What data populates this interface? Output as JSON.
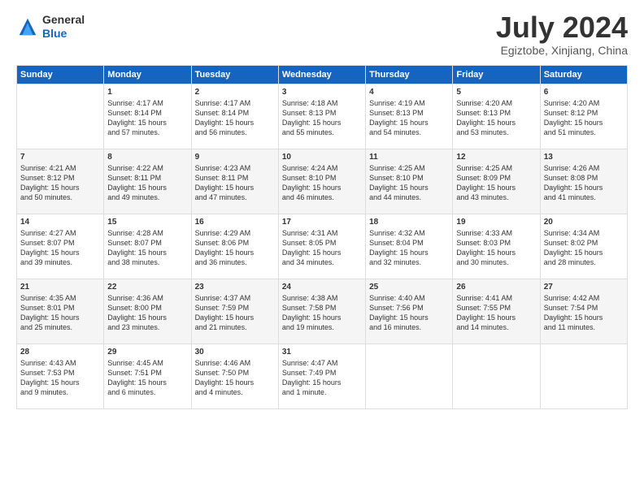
{
  "header": {
    "logo": {
      "general": "General",
      "blue": "Blue"
    },
    "title": "July 2024",
    "location": "Egiztobe, Xinjiang, China"
  },
  "weekdays": [
    "Sunday",
    "Monday",
    "Tuesday",
    "Wednesday",
    "Thursday",
    "Friday",
    "Saturday"
  ],
  "weeks": [
    [
      {
        "day": "",
        "info": ""
      },
      {
        "day": "1",
        "info": "Sunrise: 4:17 AM\nSunset: 8:14 PM\nDaylight: 15 hours\nand 57 minutes."
      },
      {
        "day": "2",
        "info": "Sunrise: 4:17 AM\nSunset: 8:14 PM\nDaylight: 15 hours\nand 56 minutes."
      },
      {
        "day": "3",
        "info": "Sunrise: 4:18 AM\nSunset: 8:13 PM\nDaylight: 15 hours\nand 55 minutes."
      },
      {
        "day": "4",
        "info": "Sunrise: 4:19 AM\nSunset: 8:13 PM\nDaylight: 15 hours\nand 54 minutes."
      },
      {
        "day": "5",
        "info": "Sunrise: 4:20 AM\nSunset: 8:13 PM\nDaylight: 15 hours\nand 53 minutes."
      },
      {
        "day": "6",
        "info": "Sunrise: 4:20 AM\nSunset: 8:12 PM\nDaylight: 15 hours\nand 51 minutes."
      }
    ],
    [
      {
        "day": "7",
        "info": "Sunrise: 4:21 AM\nSunset: 8:12 PM\nDaylight: 15 hours\nand 50 minutes."
      },
      {
        "day": "8",
        "info": "Sunrise: 4:22 AM\nSunset: 8:11 PM\nDaylight: 15 hours\nand 49 minutes."
      },
      {
        "day": "9",
        "info": "Sunrise: 4:23 AM\nSunset: 8:11 PM\nDaylight: 15 hours\nand 47 minutes."
      },
      {
        "day": "10",
        "info": "Sunrise: 4:24 AM\nSunset: 8:10 PM\nDaylight: 15 hours\nand 46 minutes."
      },
      {
        "day": "11",
        "info": "Sunrise: 4:25 AM\nSunset: 8:10 PM\nDaylight: 15 hours\nand 44 minutes."
      },
      {
        "day": "12",
        "info": "Sunrise: 4:25 AM\nSunset: 8:09 PM\nDaylight: 15 hours\nand 43 minutes."
      },
      {
        "day": "13",
        "info": "Sunrise: 4:26 AM\nSunset: 8:08 PM\nDaylight: 15 hours\nand 41 minutes."
      }
    ],
    [
      {
        "day": "14",
        "info": "Sunrise: 4:27 AM\nSunset: 8:07 PM\nDaylight: 15 hours\nand 39 minutes."
      },
      {
        "day": "15",
        "info": "Sunrise: 4:28 AM\nSunset: 8:07 PM\nDaylight: 15 hours\nand 38 minutes."
      },
      {
        "day": "16",
        "info": "Sunrise: 4:29 AM\nSunset: 8:06 PM\nDaylight: 15 hours\nand 36 minutes."
      },
      {
        "day": "17",
        "info": "Sunrise: 4:31 AM\nSunset: 8:05 PM\nDaylight: 15 hours\nand 34 minutes."
      },
      {
        "day": "18",
        "info": "Sunrise: 4:32 AM\nSunset: 8:04 PM\nDaylight: 15 hours\nand 32 minutes."
      },
      {
        "day": "19",
        "info": "Sunrise: 4:33 AM\nSunset: 8:03 PM\nDaylight: 15 hours\nand 30 minutes."
      },
      {
        "day": "20",
        "info": "Sunrise: 4:34 AM\nSunset: 8:02 PM\nDaylight: 15 hours\nand 28 minutes."
      }
    ],
    [
      {
        "day": "21",
        "info": "Sunrise: 4:35 AM\nSunset: 8:01 PM\nDaylight: 15 hours\nand 25 minutes."
      },
      {
        "day": "22",
        "info": "Sunrise: 4:36 AM\nSunset: 8:00 PM\nDaylight: 15 hours\nand 23 minutes."
      },
      {
        "day": "23",
        "info": "Sunrise: 4:37 AM\nSunset: 7:59 PM\nDaylight: 15 hours\nand 21 minutes."
      },
      {
        "day": "24",
        "info": "Sunrise: 4:38 AM\nSunset: 7:58 PM\nDaylight: 15 hours\nand 19 minutes."
      },
      {
        "day": "25",
        "info": "Sunrise: 4:40 AM\nSunset: 7:56 PM\nDaylight: 15 hours\nand 16 minutes."
      },
      {
        "day": "26",
        "info": "Sunrise: 4:41 AM\nSunset: 7:55 PM\nDaylight: 15 hours\nand 14 minutes."
      },
      {
        "day": "27",
        "info": "Sunrise: 4:42 AM\nSunset: 7:54 PM\nDaylight: 15 hours\nand 11 minutes."
      }
    ],
    [
      {
        "day": "28",
        "info": "Sunrise: 4:43 AM\nSunset: 7:53 PM\nDaylight: 15 hours\nand 9 minutes."
      },
      {
        "day": "29",
        "info": "Sunrise: 4:45 AM\nSunset: 7:51 PM\nDaylight: 15 hours\nand 6 minutes."
      },
      {
        "day": "30",
        "info": "Sunrise: 4:46 AM\nSunset: 7:50 PM\nDaylight: 15 hours\nand 4 minutes."
      },
      {
        "day": "31",
        "info": "Sunrise: 4:47 AM\nSunset: 7:49 PM\nDaylight: 15 hours\nand 1 minute."
      },
      {
        "day": "",
        "info": ""
      },
      {
        "day": "",
        "info": ""
      },
      {
        "day": "",
        "info": ""
      }
    ]
  ]
}
